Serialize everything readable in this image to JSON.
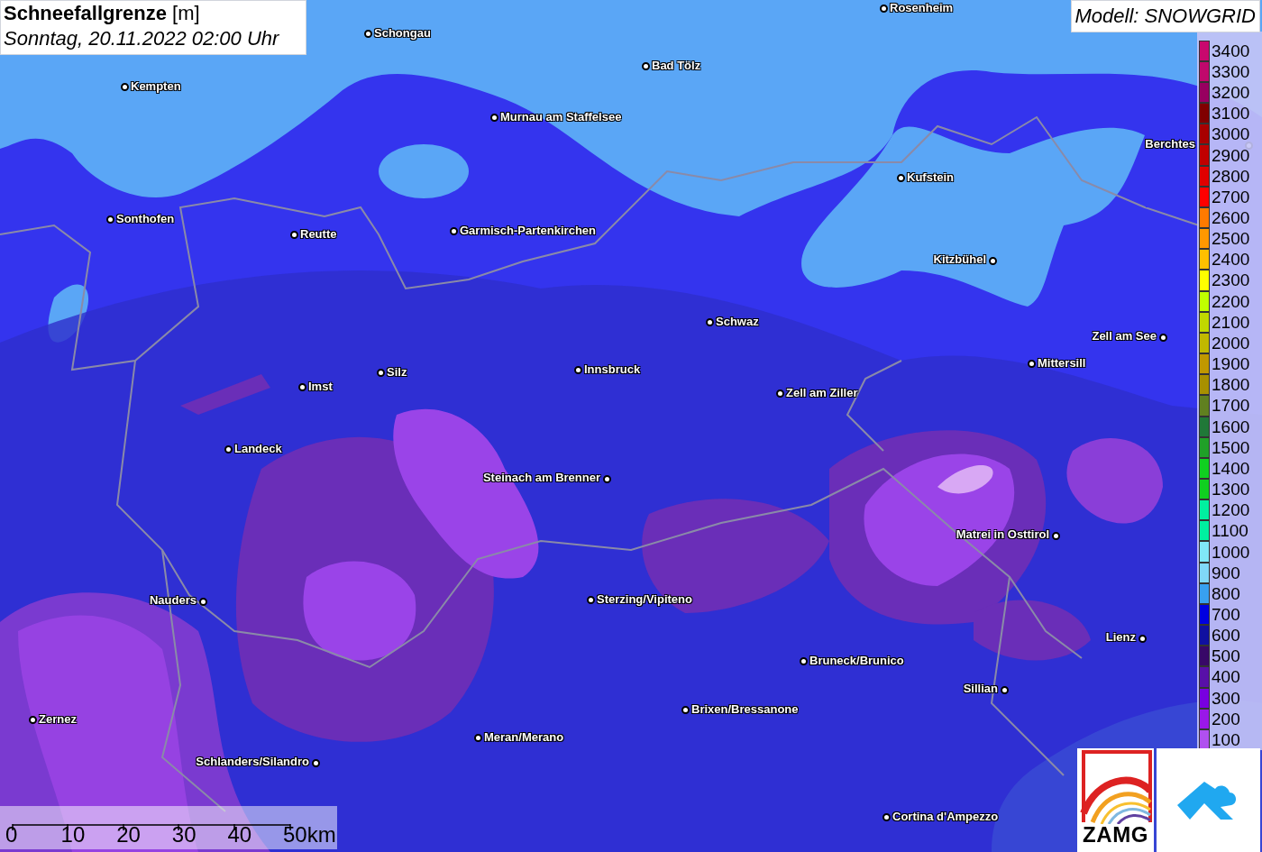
{
  "title": {
    "heading": "**Schneefallgrenze** [m]",
    "subtitle": "Sonntag, 20.11.2022 02:00 Uhr"
  },
  "model": "Modell: SNOWGRID",
  "cities": [
    {
      "name": "Rosenheim"
    },
    {
      "name": "Schongau"
    },
    {
      "name": "Bad Tölz"
    },
    {
      "name": "Kempten"
    },
    {
      "name": "Murnau am Staffelsee"
    },
    {
      "name": "Berchtes"
    },
    {
      "name": "Kufstein"
    },
    {
      "name": "Sonthofen"
    },
    {
      "name": "Reutte"
    },
    {
      "name": "Garmisch-Partenkirchen"
    },
    {
      "name": "Kitzbühel"
    },
    {
      "name": "Schwaz"
    },
    {
      "name": "Zell am See"
    },
    {
      "name": "Mittersill"
    },
    {
      "name": "Innsbruck"
    },
    {
      "name": "Silz"
    },
    {
      "name": "Imst"
    },
    {
      "name": "Zell am Ziller"
    },
    {
      "name": "Landeck"
    },
    {
      "name": "Steinach am Brenner"
    },
    {
      "name": "Matrei in Osttirol"
    },
    {
      "name": "Nauders"
    },
    {
      "name": "Sterzing/Vipiteno"
    },
    {
      "name": "Lienz"
    },
    {
      "name": "Bruneck/Brunico"
    },
    {
      "name": "Sillian"
    },
    {
      "name": "Brixen/Bressanone"
    },
    {
      "name": "Zernez"
    },
    {
      "name": "Meran/Merano"
    },
    {
      "name": "Schlanders/Silandro"
    },
    {
      "name": "Cortina d'Ampezzo"
    }
  ],
  "legend": [
    {
      "label": "3400",
      "color": "#c8086e"
    },
    {
      "label": "3300",
      "color": "#c0086c"
    },
    {
      "label": "3200",
      "color": "#980060"
    },
    {
      "label": "3100",
      "color": "#800000"
    },
    {
      "label": "3000",
      "color": "#a80000"
    },
    {
      "label": "2900",
      "color": "#c00000"
    },
    {
      "label": "2800",
      "color": "#e00000"
    },
    {
      "label": "2700",
      "color": "#ff0000"
    },
    {
      "label": "2600",
      "color": "#ff7a00"
    },
    {
      "label": "2500",
      "color": "#ff9800"
    },
    {
      "label": "2400",
      "color": "#ffc000"
    },
    {
      "label": "2300",
      "color": "#ffff00"
    },
    {
      "label": "2200",
      "color": "#c0ff00"
    },
    {
      "label": "2100",
      "color": "#c0d800"
    },
    {
      "label": "2000",
      "color": "#c0b800"
    },
    {
      "label": "1900",
      "color": "#c09800"
    },
    {
      "label": "1800",
      "color": "#a89000"
    },
    {
      "label": "1700",
      "color": "#608020"
    },
    {
      "label": "1600",
      "color": "#207838"
    },
    {
      "label": "1500",
      "color": "#20a028"
    },
    {
      "label": "1400",
      "color": "#10d020"
    },
    {
      "label": "1300",
      "color": "#10d020"
    },
    {
      "label": "1200",
      "color": "#00f0a0"
    },
    {
      "label": "1100",
      "color": "#00f0a0"
    },
    {
      "label": "1000",
      "color": "#80e8f8"
    },
    {
      "label": "900",
      "color": "#80d8f8"
    },
    {
      "label": "800",
      "color": "#38a0f0"
    },
    {
      "label": "700",
      "color": "#0000e0"
    },
    {
      "label": "600",
      "color": "#1010a0"
    },
    {
      "label": "500",
      "color": "#380868"
    },
    {
      "label": "400",
      "color": "#5810a8"
    },
    {
      "label": "300",
      "color": "#7800e0"
    },
    {
      "label": "200",
      "color": "#9a18e8"
    },
    {
      "label": "100",
      "color": "#b050f0"
    }
  ],
  "scale": {
    "ticks": [
      "0",
      "10",
      "20",
      "30",
      "40",
      "50km"
    ]
  },
  "logos": {
    "left": "ZAMG"
  }
}
